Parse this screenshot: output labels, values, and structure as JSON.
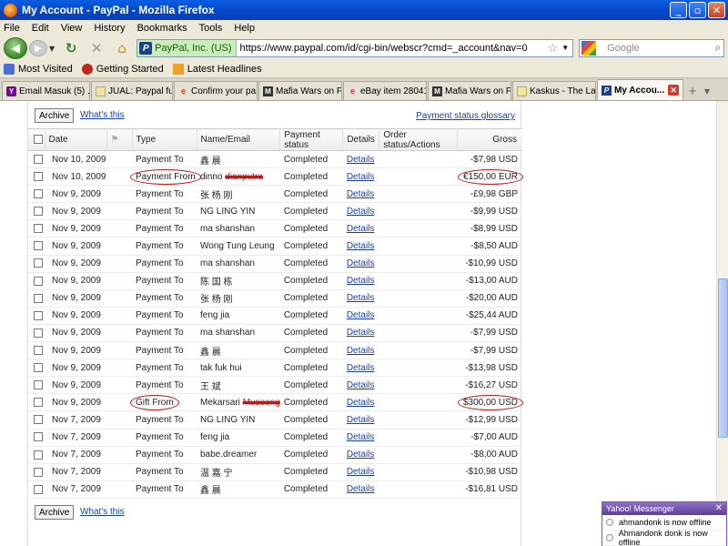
{
  "window": {
    "title": "My Account - PayPal - Mozilla Firefox"
  },
  "menu": [
    "File",
    "Edit",
    "View",
    "History",
    "Bookmarks",
    "Tools",
    "Help"
  ],
  "nav": {
    "identity": "PayPal, Inc. (US)",
    "url": "https://www.paypal.com/id/cgi-bin/webscr?cmd=_account&nav=0",
    "search_placeholder": "Google"
  },
  "bookmarks": [
    "Most Visited",
    "Getting Started",
    "Latest Headlines"
  ],
  "tabs": [
    {
      "label": "Email Masuk (5) ...",
      "icon": "yahoo-icon"
    },
    {
      "label": "JUAL: Paypal fu...",
      "icon": "page-icon"
    },
    {
      "label": "Confirm your pa...",
      "icon": "ebay-icon"
    },
    {
      "label": "Mafia Wars on F...",
      "icon": "mafia-icon"
    },
    {
      "label": "eBay item 28041...",
      "icon": "ebay-icon"
    },
    {
      "label": "Mafia Wars on F...",
      "icon": "mafia-icon"
    },
    {
      "label": "Kaskus - The Lar...",
      "icon": "page-icon"
    },
    {
      "label": "My Accou...",
      "icon": "paypal-icon",
      "active": true
    }
  ],
  "panel": {
    "archive_label": "Archive",
    "whats_this": "What's this",
    "glossary": "Payment status glossary"
  },
  "table": {
    "headers": [
      "Date",
      "",
      "Type",
      "Name/Email",
      "Payment status",
      "Details",
      "Order status/Actions",
      "Gross"
    ],
    "details_label": "Details",
    "rows": [
      {
        "date": "Nov 10, 2009",
        "type": "Payment To",
        "name": "鑫 晨",
        "status": "Completed",
        "gross": "-$7,98 USD"
      },
      {
        "date": "Nov 10, 2009",
        "type": "Payment From",
        "name": "dinno",
        "name_redacted": "dianputra",
        "status": "Completed",
        "gross": "€150,00 EUR",
        "circled": true
      },
      {
        "date": "Nov 9, 2009",
        "type": "Payment To",
        "name": "张 杨 刚",
        "status": "Completed",
        "gross": "-£9,98 GBP"
      },
      {
        "date": "Nov 9, 2009",
        "type": "Payment To",
        "name": "NG LING YIN",
        "status": "Completed",
        "gross": "-$9,99 USD"
      },
      {
        "date": "Nov 9, 2009",
        "type": "Payment To",
        "name": "ma shanshan",
        "status": "Completed",
        "gross": "-$8,99 USD"
      },
      {
        "date": "Nov 9, 2009",
        "type": "Payment To",
        "name": "Wong Tung Leung",
        "status": "Completed",
        "gross": "-$8,50 AUD"
      },
      {
        "date": "Nov 9, 2009",
        "type": "Payment To",
        "name": "ma shanshan",
        "status": "Completed",
        "gross": "-$10,99 USD"
      },
      {
        "date": "Nov 9, 2009",
        "type": "Payment To",
        "name": "陈 国 栋",
        "status": "Completed",
        "gross": "-$13,00 AUD"
      },
      {
        "date": "Nov 9, 2009",
        "type": "Payment To",
        "name": "张 杨 刚",
        "status": "Completed",
        "gross": "-$20,00 AUD"
      },
      {
        "date": "Nov 9, 2009",
        "type": "Payment To",
        "name": "feng jia",
        "status": "Completed",
        "gross": "-$25,44 AUD"
      },
      {
        "date": "Nov 9, 2009",
        "type": "Payment To",
        "name": "ma shanshan",
        "status": "Completed",
        "gross": "-$7,99 USD"
      },
      {
        "date": "Nov 9, 2009",
        "type": "Payment To",
        "name": "鑫 晨",
        "status": "Completed",
        "gross": "-$7,99 USD"
      },
      {
        "date": "Nov 9, 2009",
        "type": "Payment To",
        "name": "tak fuk hui",
        "status": "Completed",
        "gross": "-$13,98 USD"
      },
      {
        "date": "Nov 9, 2009",
        "type": "Payment To",
        "name": "王 斌",
        "status": "Completed",
        "gross": "-$16,27 USD"
      },
      {
        "date": "Nov 9, 2009",
        "type": "Gift From",
        "name": "Mekarsari",
        "name_redacted": "Musoong",
        "status": "Completed",
        "gross": "$300,00 USD",
        "circled": true
      },
      {
        "date": "Nov 7, 2009",
        "type": "Payment To",
        "name": "NG LING YIN",
        "status": "Completed",
        "gross": "-$12,99 USD"
      },
      {
        "date": "Nov 7, 2009",
        "type": "Payment To",
        "name": "feng jia",
        "status": "Completed",
        "gross": "-$7,00 AUD"
      },
      {
        "date": "Nov 7, 2009",
        "type": "Payment To",
        "name": "babe.dreamer",
        "status": "Completed",
        "gross": "-$8,00 AUD"
      },
      {
        "date": "Nov 7, 2009",
        "type": "Payment To",
        "name": "温 嘉 宁",
        "status": "Completed",
        "gross": "-$10,98 USD"
      },
      {
        "date": "Nov 7, 2009",
        "type": "Payment To",
        "name": "鑫 晨",
        "status": "Completed",
        "gross": "-$16,81 USD"
      }
    ]
  },
  "messenger": {
    "title": "Yahoo! Messenger",
    "notices": [
      "ahmandonk is now offline",
      "Ahmandonk donk is now offline"
    ]
  },
  "colors": {
    "annotation_red": "#c01818",
    "link_blue": "#1a3f9c"
  }
}
